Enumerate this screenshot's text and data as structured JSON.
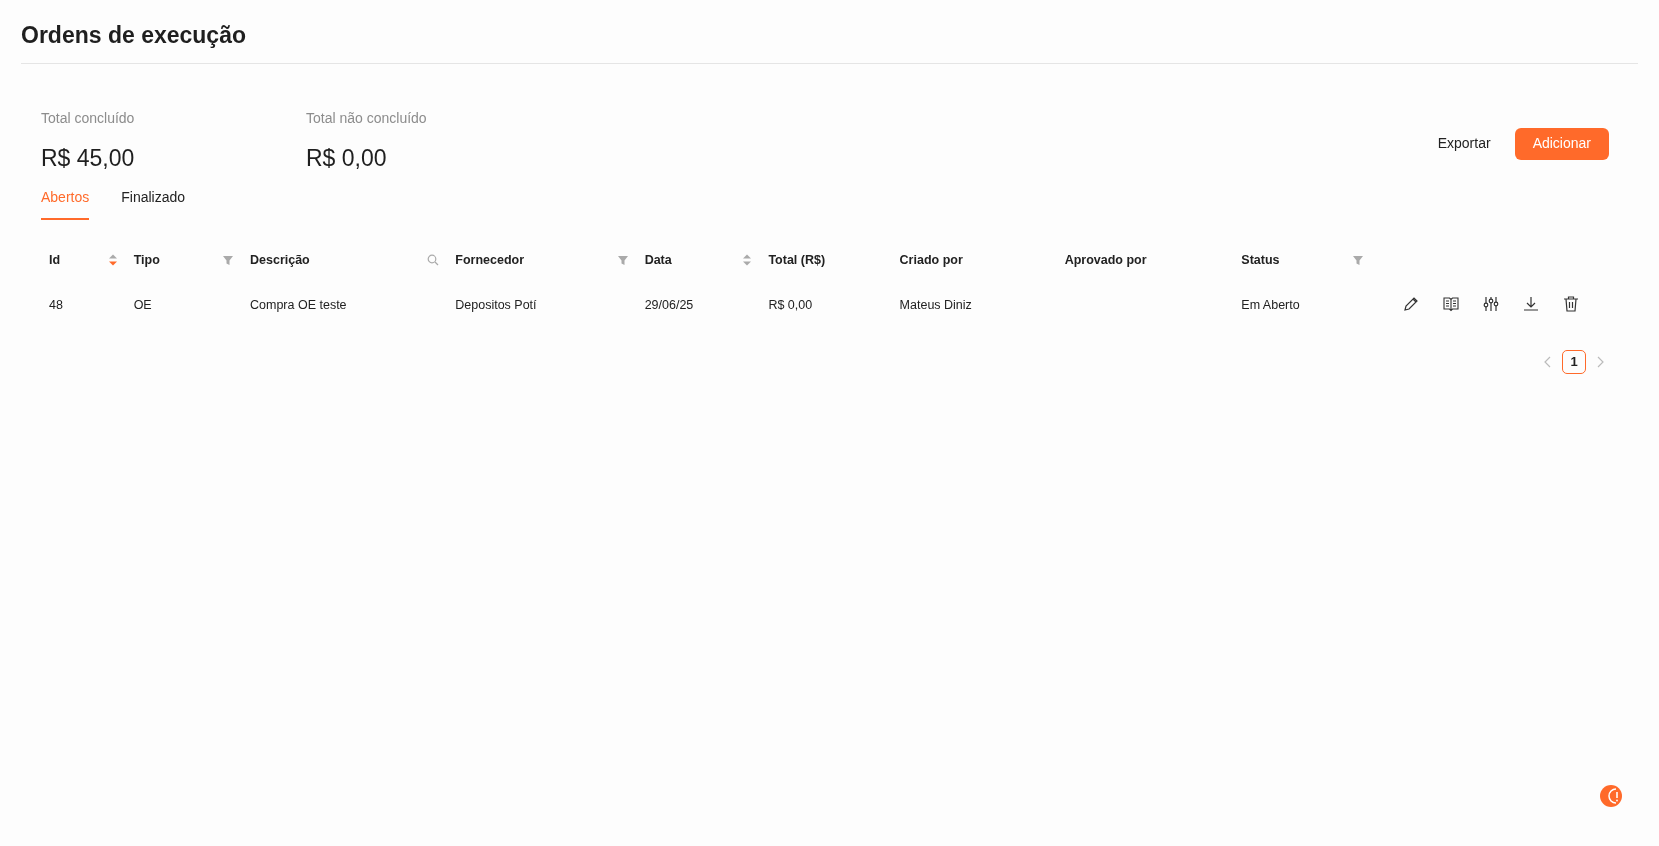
{
  "page_title": "Ordens de execução",
  "summary": [
    {
      "label": "Total concluído",
      "value": "R$ 45,00"
    },
    {
      "label": "Total não concluído",
      "value": "R$ 0,00"
    }
  ],
  "actions": [
    {
      "label": "Exportar",
      "kind": "text"
    },
    {
      "label": "Adicionar",
      "kind": "primary"
    }
  ],
  "tabs": [
    {
      "label": "Abertos",
      "selected": true
    },
    {
      "label": "Finalizado",
      "selected": false
    }
  ],
  "table": {
    "columns": [
      {
        "label": "Id",
        "kind": "sort",
        "sorted_descending": true
      },
      {
        "label": "Tipo",
        "kind": "filter"
      },
      {
        "label": "Descrição",
        "kind": "search"
      },
      {
        "label": "Fornecedor",
        "kind": "filter"
      },
      {
        "label": "Data",
        "kind": "sort",
        "sorted_descending": false
      },
      {
        "label": "Total (R$)",
        "kind": "plain"
      },
      {
        "label": "Criado por",
        "kind": "plain"
      },
      {
        "label": "Aprovado por",
        "kind": "plain"
      },
      {
        "label": "Status",
        "kind": "filter"
      }
    ],
    "rows": [
      {
        "cells": [
          "48",
          "OE",
          "Compra OE teste",
          "Depositos Potí",
          "29/06/25",
          "R$ 0,00",
          "Mateus Diniz",
          "",
          "Em Aberto"
        ],
        "row_actions": [
          {
            "kind": "edit"
          },
          {
            "kind": "book"
          },
          {
            "kind": "sliders"
          },
          {
            "kind": "download"
          },
          {
            "kind": "delete"
          }
        ]
      }
    ]
  },
  "pagination": {
    "pages": [
      {
        "label": "1",
        "selected": true
      }
    ]
  }
}
